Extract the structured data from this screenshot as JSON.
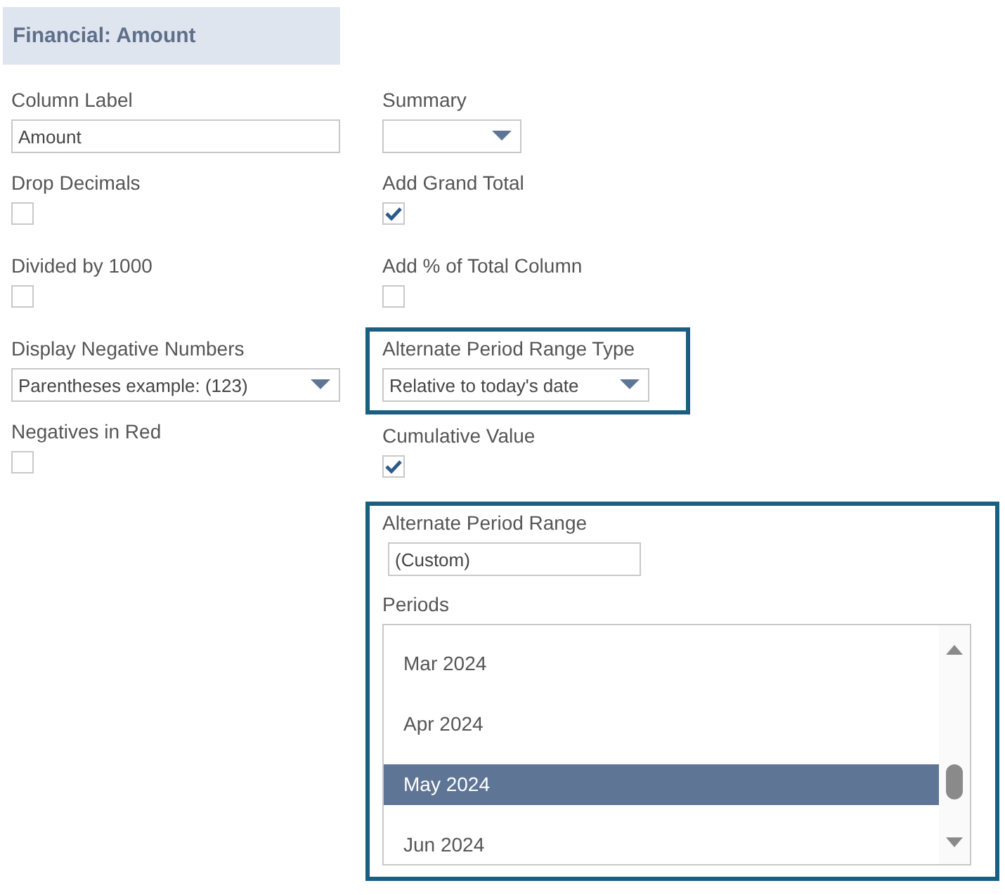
{
  "header": {
    "title": "Financial: Amount"
  },
  "left": [
    {
      "kind": "text",
      "label": "Column Label",
      "value": "Amount"
    },
    {
      "kind": "checkbox",
      "label": "Drop Decimals",
      "checked": false
    },
    {
      "kind": "checkbox",
      "label": "Divided by 1000",
      "checked": false
    },
    {
      "kind": "select",
      "label": "Display Negative Numbers",
      "value": "Parentheses  example: (123)",
      "highlighted": false
    },
    {
      "kind": "checkbox",
      "label": "Negatives in Red",
      "checked": false
    }
  ],
  "right": [
    {
      "kind": "select",
      "label": "Summary",
      "highlighted": false
    },
    {
      "kind": "checkbox",
      "label": "Add Grand Total",
      "checked": true
    },
    {
      "kind": "checkbox",
      "label": "Add % of Total Column",
      "checked": false
    },
    {
      "kind": "select",
      "label": "Alternate Period Range Type",
      "value": "Relative to today's date",
      "highlighted": true
    },
    {
      "kind": "checkbox",
      "label": "Cumulative Value",
      "checked": true
    },
    {
      "kind": "group",
      "highlighted": true,
      "fields": [
        {
          "kind": "text",
          "label": "Alternate Period Range",
          "value": "(Custom)"
        },
        {
          "kind": "list",
          "label": "Periods",
          "items": [
            {
              "label": "Mar 2024",
              "selected": false
            },
            {
              "label": "Apr 2024",
              "selected": false
            },
            {
              "label": "May 2024",
              "selected": true
            },
            {
              "label": "Jun 2024",
              "selected": false
            }
          ]
        }
      ]
    }
  ]
}
